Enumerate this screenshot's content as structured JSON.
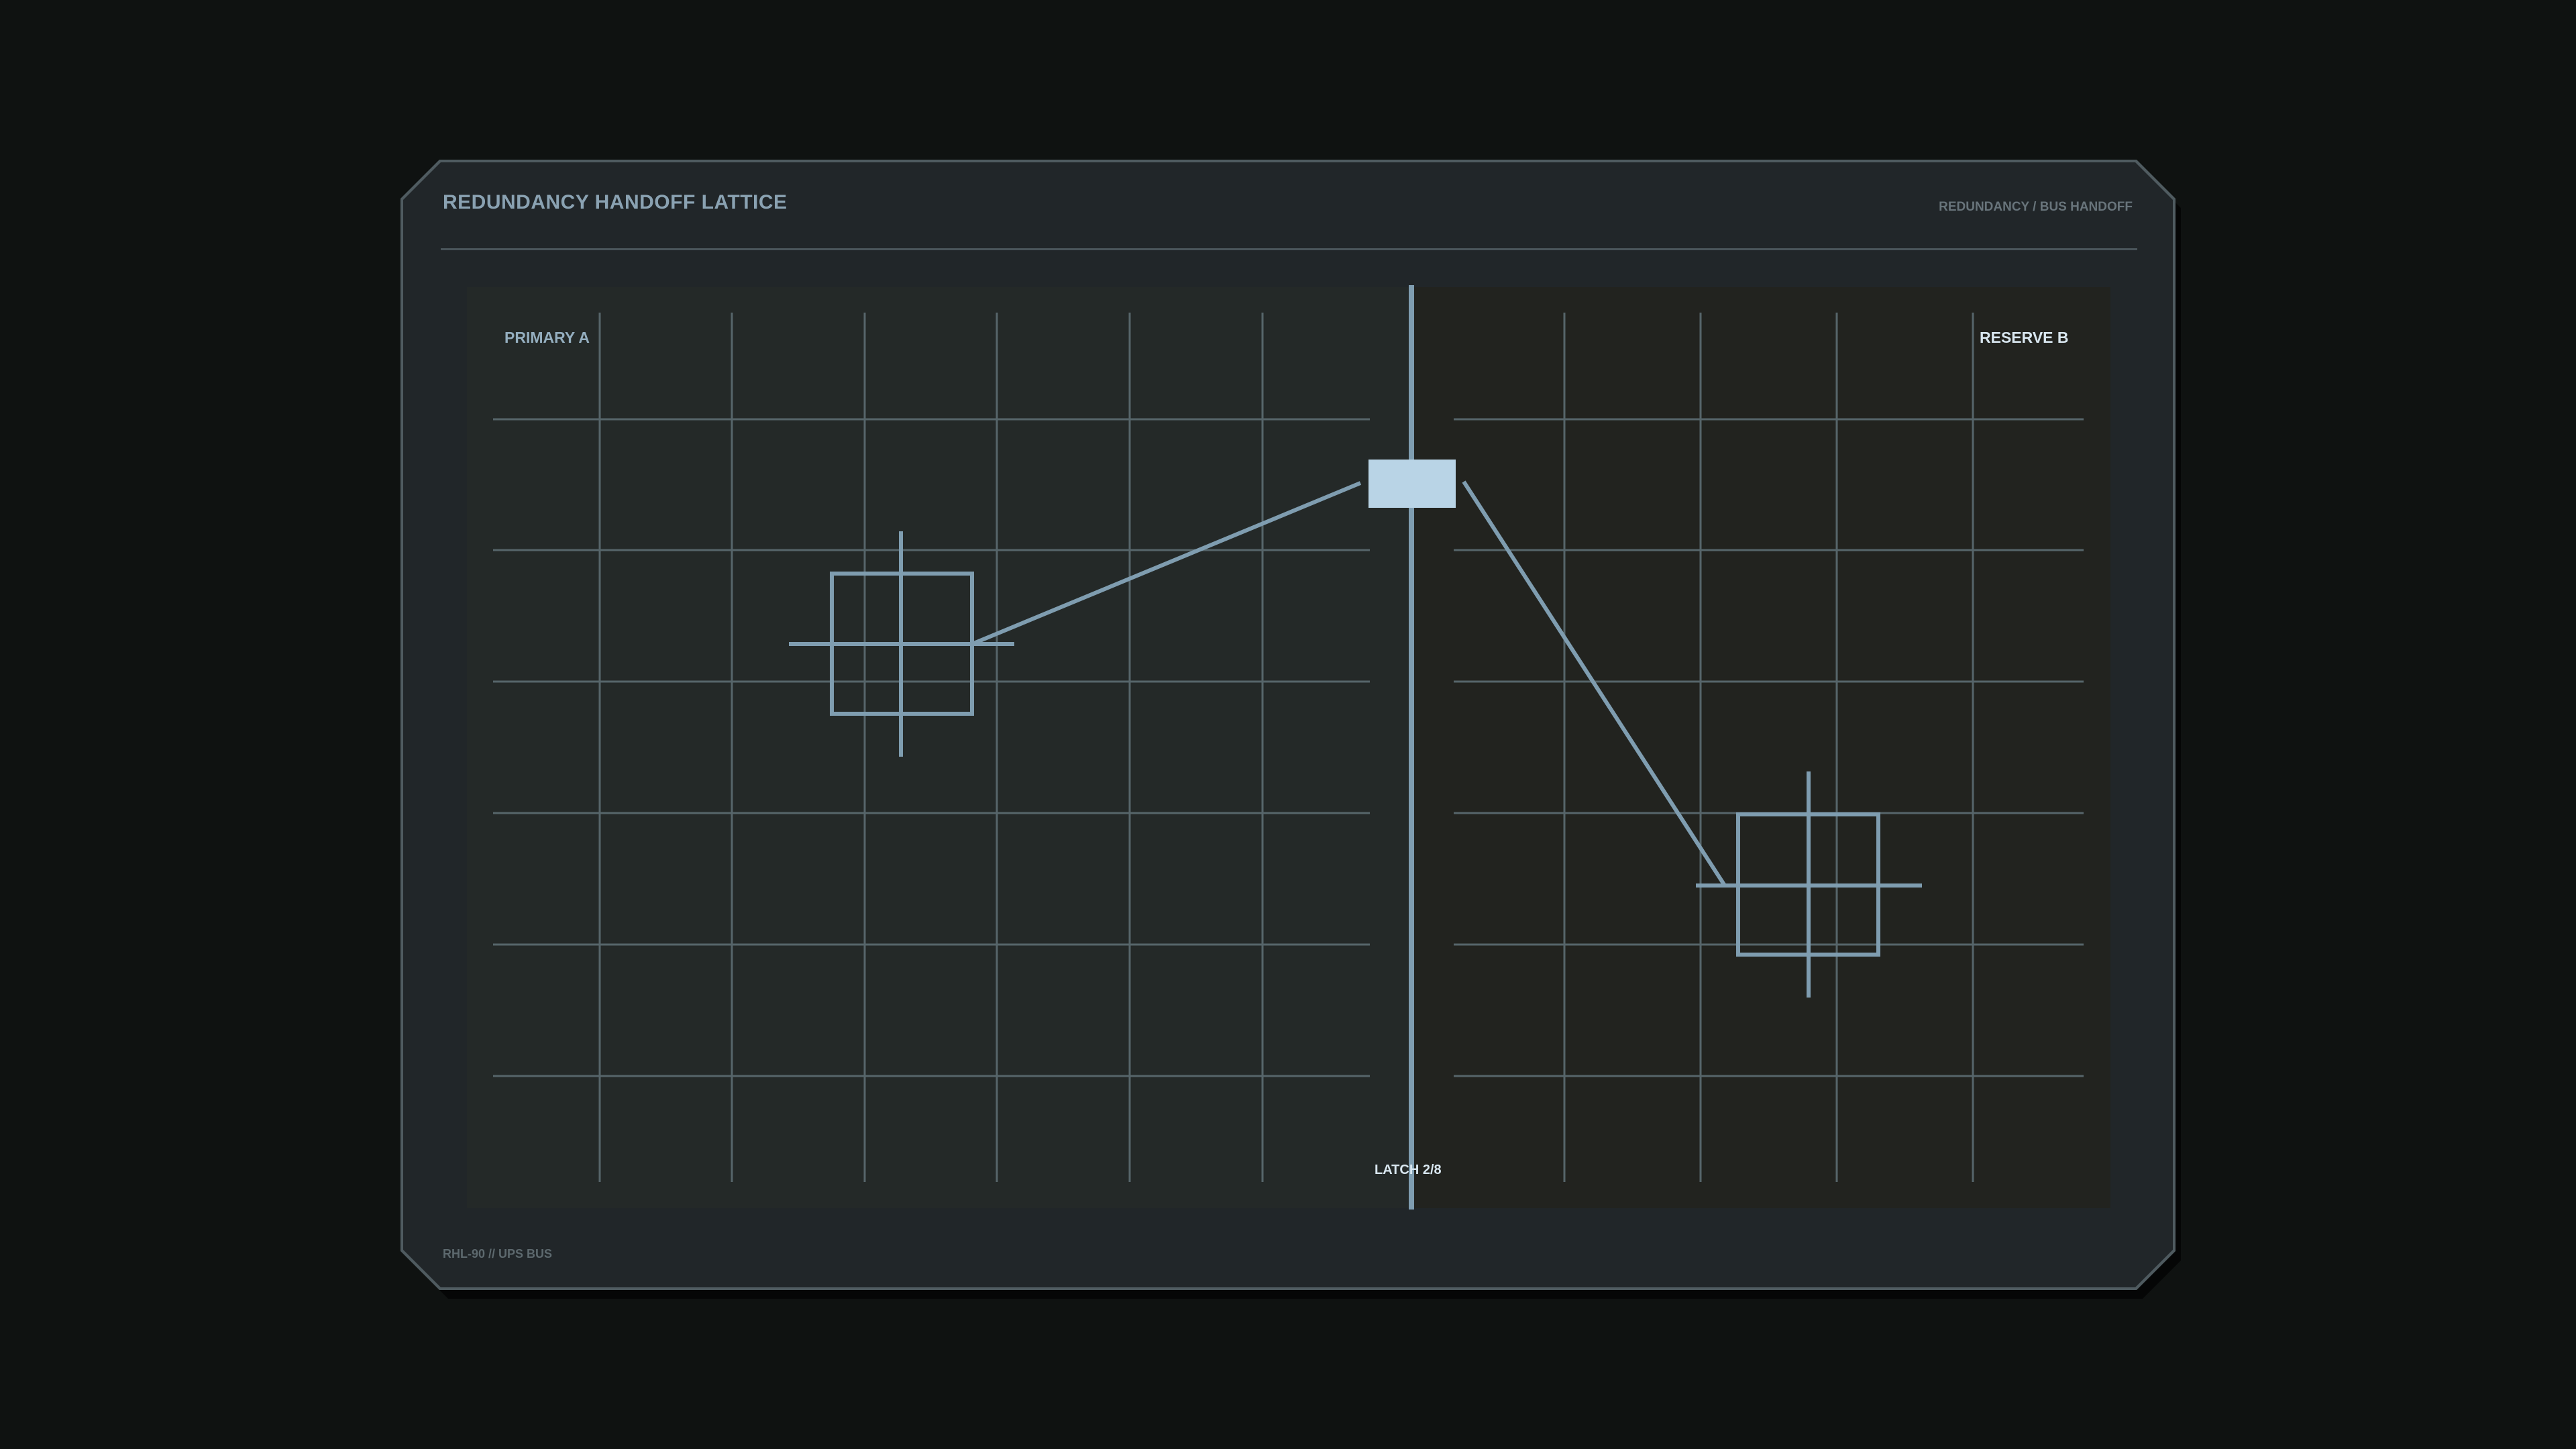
{
  "title": "REDUNDANCY HANDOFF LATTICE",
  "subtitle": "REDUNDANCY / BUS HANDOFF",
  "footer": "RHL-90  //  UPS BUS",
  "zones": {
    "primary": {
      "label": "PRIMARY  A"
    },
    "reserve": {
      "label": "RESERVE  B"
    }
  },
  "latch": {
    "label": "LATCH 2/8"
  },
  "colors": {
    "background": "#0f1211",
    "panel": "#212629",
    "primary_zone": "#242928",
    "reserve_zone": "#22231f",
    "grid": "#56656a",
    "accent": "#7f9db0",
    "latch_block": "#b9d4e6"
  }
}
